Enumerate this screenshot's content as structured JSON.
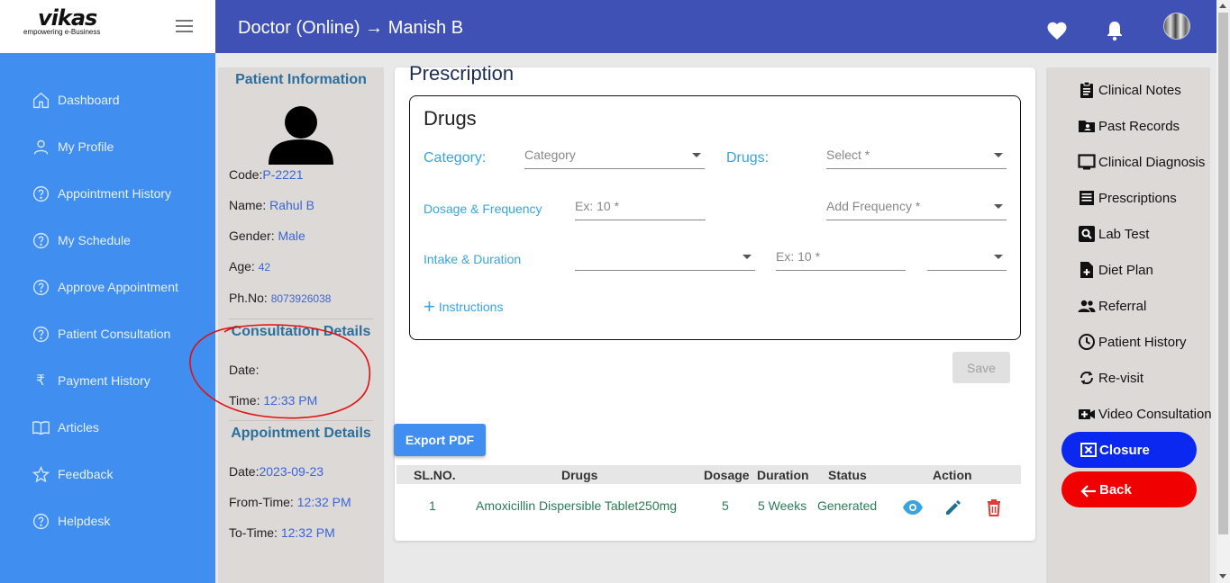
{
  "brand": {
    "logo": "vikas",
    "tagline": "empowering e-Business"
  },
  "sidebar": {
    "items": [
      {
        "label": "Dashboard",
        "icon": "home-icon"
      },
      {
        "label": "My Profile",
        "icon": "person-icon"
      },
      {
        "label": "Appointment History",
        "icon": "help-circle-icon"
      },
      {
        "label": "My Schedule",
        "icon": "help-circle-icon"
      },
      {
        "label": "Approve Appointment",
        "icon": "help-circle-icon"
      },
      {
        "label": "Patient Consultation",
        "icon": "help-circle-icon"
      },
      {
        "label": "Payment History",
        "icon": "rupee-icon"
      },
      {
        "label": "Articles",
        "icon": "book-icon"
      },
      {
        "label": "Feedback",
        "icon": "star-icon"
      },
      {
        "label": "Helpdesk",
        "icon": "help-circle-icon"
      }
    ]
  },
  "header": {
    "title": "Doctor (Online) → Manish B"
  },
  "patient": {
    "heading": "Patient Information",
    "code_label": "Code:",
    "code": "P-2221",
    "name_label": "Name: ",
    "name": "Rahul B",
    "gender_label": "Gender: ",
    "gender": "Male",
    "age_label": "Age: ",
    "age": "42",
    "phone_label": "Ph.No: ",
    "phone": "8073926038"
  },
  "consultation": {
    "heading": "Consultation Details",
    "date_label": "Date:",
    "date": "",
    "time_label": "Time: ",
    "time": "12:33 PM"
  },
  "appointment": {
    "heading": "Appointment Details",
    "date_label": "Date:",
    "date": "2023-09-23",
    "from_label": "From-Time: ",
    "from": "12:32 PM",
    "to_label": "To-Time: ",
    "to": "12:32 PM"
  },
  "prescription": {
    "title": "Prescription",
    "drugs_box_title": "Drugs",
    "category_label": "Category:",
    "category_placeholder": "Category",
    "drugs_label": "Drugs:",
    "drugs_placeholder": "Select *",
    "dosage_label": "Dosage & Frequency",
    "dosage_placeholder": "Ex: 10 *",
    "frequency_placeholder": "Add Frequency *",
    "intake_label": "Intake & Duration",
    "intake_value": "",
    "duration_placeholder": "Ex: 10 *",
    "duration_unit": "",
    "instructions_label": "Instructions",
    "save_label": "Save",
    "export_label": "Export PDF"
  },
  "table": {
    "columns": [
      "SL.NO.",
      "Drugs",
      "Dosage",
      "Duration",
      "Status",
      "Action"
    ],
    "rows": [
      {
        "sl": "1",
        "drug": "Amoxicillin Dispersible Tablet250mg",
        "dosage": "5",
        "duration": "5 Weeks",
        "status": "Generated"
      }
    ]
  },
  "right_menu": {
    "items": [
      {
        "label": "Clinical Notes",
        "icon": "clipboard-icon"
      },
      {
        "label": "Past Records",
        "icon": "folder-person-icon"
      },
      {
        "label": "Clinical Diagnosis",
        "icon": "monitor-icon"
      },
      {
        "label": "Prescriptions",
        "icon": "list-icon"
      },
      {
        "label": "Lab Test",
        "icon": "search-box-icon"
      },
      {
        "label": "Diet Plan",
        "icon": "file-plus-icon"
      },
      {
        "label": "Referral",
        "icon": "people-icon"
      },
      {
        "label": "Patient History",
        "icon": "clock-icon"
      },
      {
        "label": "Re-visit",
        "icon": "refresh-icon"
      },
      {
        "label": "Video Consultation",
        "icon": "video-add-icon"
      }
    ],
    "closure_label": "Closure",
    "back_label": "Back"
  },
  "colors": {
    "sidebar": "#3f8ef0",
    "header": "#3f51b5",
    "closure": "#0a28ef",
    "back": "#f00000",
    "link": "#3aa4de",
    "annotation": "#e01010"
  }
}
